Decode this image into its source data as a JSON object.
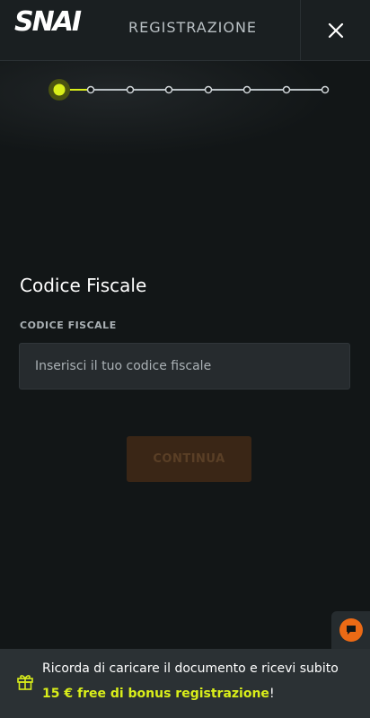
{
  "header": {
    "logo_text": "SNAI",
    "title": "REGISTRAZIONE",
    "close_icon": "close-icon"
  },
  "stepper": {
    "total_steps": 8,
    "current_step": 1,
    "active_color": "#d9ee1a",
    "inactive_color": "#b9c0c4"
  },
  "form": {
    "section_title": "Codice Fiscale",
    "field_label": "CODICE FISCALE",
    "field_placeholder": "Inserisci il tuo codice fiscale",
    "field_value": "",
    "continue_label": "CONTINUA"
  },
  "chat": {
    "icon": "chat-icon",
    "accent": "#ec6a15"
  },
  "banner": {
    "icon": "gift-icon",
    "line1": "Ricorda di caricare il documento e ricevi subito",
    "highlight": "15 € free di bonus registrazione",
    "suffix": "!"
  }
}
